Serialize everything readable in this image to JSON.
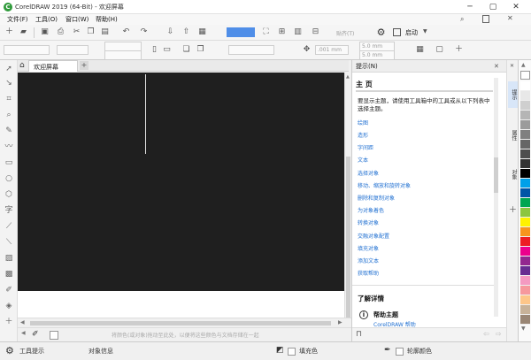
{
  "window": {
    "title": "CorelDRAW 2019 (64-Bit) - 欢迎屏幕",
    "logo": "C"
  },
  "menu": [
    {
      "label": "文件(F)"
    },
    {
      "label": "工具(O)"
    },
    {
      "label": "窗口(W)"
    },
    {
      "label": "帮助(H)"
    }
  ],
  "toolbar": {
    "zoom_value": "",
    "launch_label": "启动",
    "snap_label": "贴齐(T)"
  },
  "propbar": {
    "nudge": ".001 mm",
    "dup_x": "5.0 mm",
    "dup_y": "5.0 mm"
  },
  "doc_tab": {
    "label": "欢迎屏幕",
    "add": "+"
  },
  "hints": {
    "panel_title": "提示(N)",
    "heading": "主 页",
    "intro": "要显示主题，请使用工具箱中的工具或从以下列表中选择主题。",
    "topics": [
      "绘图",
      "造形",
      "字间距",
      "文本",
      "选择对象",
      "移动、缩放和旋转对象",
      "删除和复制对象",
      "为对象着色",
      "转换对象",
      "交融对象配置",
      "填充对象",
      "添加文本",
      "获取帮助"
    ],
    "learn_more": "了解详情",
    "help_topic": "帮助主题",
    "help_link": "CorelDRAW 帮助"
  },
  "side_tabs": [
    "提示",
    "属性",
    "对象"
  ],
  "palette": [
    "#ffffff",
    "#e8e8e8",
    "#cfcfcf",
    "#b5b5b5",
    "#9b9b9b",
    "#808080",
    "#666666",
    "#4d4d4d",
    "#333333",
    "#000000",
    "#00a0e9",
    "#0054a6",
    "#00a651",
    "#8dc63f",
    "#fff200",
    "#f7941d",
    "#ed1c24",
    "#ec008c",
    "#92278f",
    "#662d91",
    "#f49ac1",
    "#f6989d",
    "#fdc689",
    "#c7b299",
    "#998675"
  ],
  "statusbar": {
    "tool_hints": "工具提示",
    "object_info": "对象信息",
    "fill_label": "填充色",
    "outline_label": "轮廓颜色",
    "page_hint": "将颜色(或对象)拖动至此处，以便将这些颜色与文档存储在一起"
  }
}
